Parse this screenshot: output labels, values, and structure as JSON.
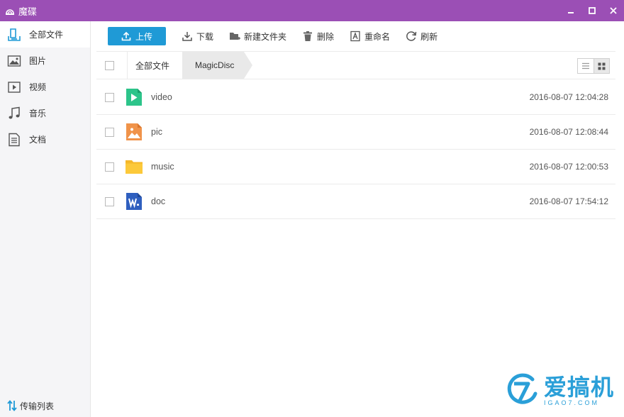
{
  "window": {
    "title": "魔碟",
    "app_icon": "disc-icon",
    "controls": [
      "minimize-icon",
      "maximize-icon",
      "close-icon"
    ],
    "accent_color": "#9b4fb5"
  },
  "sidebar": {
    "items": [
      {
        "label": "全部文件",
        "icon": "all-files-icon",
        "active": true
      },
      {
        "label": "图片",
        "icon": "image-icon",
        "active": false
      },
      {
        "label": "视频",
        "icon": "video-icon",
        "active": false
      },
      {
        "label": "音乐",
        "icon": "music-icon",
        "active": false
      },
      {
        "label": "文档",
        "icon": "document-icon",
        "active": false
      }
    ],
    "transfer_label": "传输列表"
  },
  "toolbar": {
    "upload": "上传",
    "download": "下载",
    "new_folder": "新建文件夹",
    "delete": "删除",
    "rename": "重命名",
    "refresh": "刷新",
    "upload_color": "#1f9ad6"
  },
  "breadcrumb": {
    "root": "全部文件",
    "current": "MagicDisc"
  },
  "files": [
    {
      "name": "video",
      "date": "2016-08-07 12:04:28",
      "icon": "video-file-icon"
    },
    {
      "name": "pic",
      "date": "2016-08-07 12:08:44",
      "icon": "picture-file-icon"
    },
    {
      "name": "music",
      "date": "2016-08-07 12:00:53",
      "icon": "folder-icon"
    },
    {
      "name": "doc",
      "date": "2016-08-07 17:54:12",
      "icon": "word-doc-icon"
    }
  ],
  "watermark": {
    "text": "爱搞机",
    "subtext": "IGAO7.COM"
  }
}
